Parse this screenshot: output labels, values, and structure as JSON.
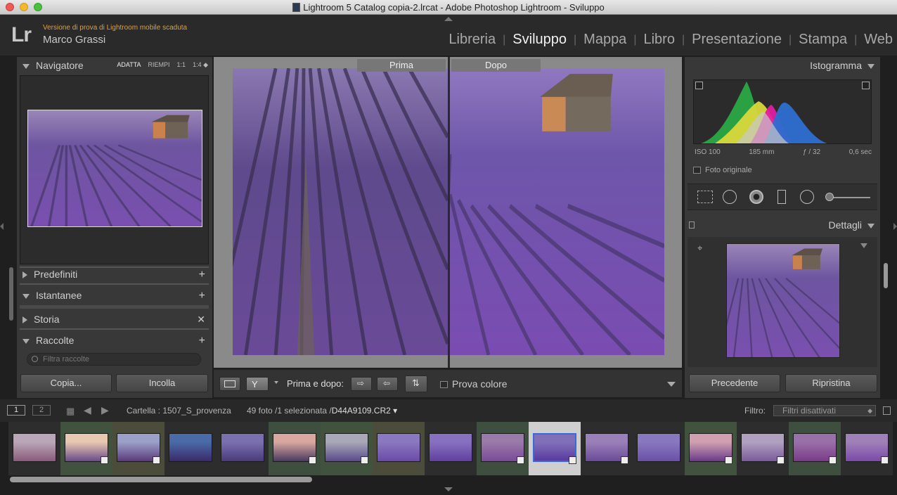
{
  "window": {
    "title": "Lightroom 5 Catalog copia-2.lrcat - Adobe Photoshop Lightroom - Sviluppo"
  },
  "identity": {
    "logo": "Lr",
    "trial": "Versione di prova di Lightroom mobile scaduta",
    "user": "Marco Grassi"
  },
  "modules": [
    {
      "label": "Libreria",
      "active": false
    },
    {
      "label": "Sviluppo",
      "active": true
    },
    {
      "label": "Mappa",
      "active": false
    },
    {
      "label": "Libro",
      "active": false
    },
    {
      "label": "Presentazione",
      "active": false
    },
    {
      "label": "Stampa",
      "active": false
    },
    {
      "label": "Web",
      "active": false
    }
  ],
  "left": {
    "navigator": {
      "title": "Navigatore",
      "opts": [
        "ADATTA",
        "RIEMPI",
        "1:1",
        "1:4 ◆"
      ]
    },
    "presets": "Predefiniti",
    "snapshots": "Istantanee",
    "history": "Storia",
    "collections": "Raccolte",
    "filter_placeholder": "Filtra raccolte",
    "copy": "Copia...",
    "paste": "Incolla"
  },
  "center": {
    "before": "Prima",
    "after": "Dopo",
    "before_after_label": "Prima e dopo:",
    "softproof": "Prova colore"
  },
  "right": {
    "histogram": "Istogramma",
    "iso": "ISO 100",
    "focal": "185 mm",
    "aperture": "ƒ / 32",
    "shutter": "0,6 sec",
    "original_photo": "Foto originale",
    "details": "Dettagli",
    "previous": "Precedente",
    "reset": "Ripristina"
  },
  "filmstrip": {
    "page1": "1",
    "page2": "2",
    "folder": "Cartella : 1507_S_provenza",
    "count": "49 foto /1 selezionata /",
    "filename": "D44A9109.CR2 ▾",
    "filter_label": "Filtro:",
    "filter_value": "Filtri disattivati",
    "selected_index": 10
  },
  "colors": {
    "accent": "#e0a03c",
    "panel": "#383838",
    "lavender": "#7a5aa0"
  }
}
